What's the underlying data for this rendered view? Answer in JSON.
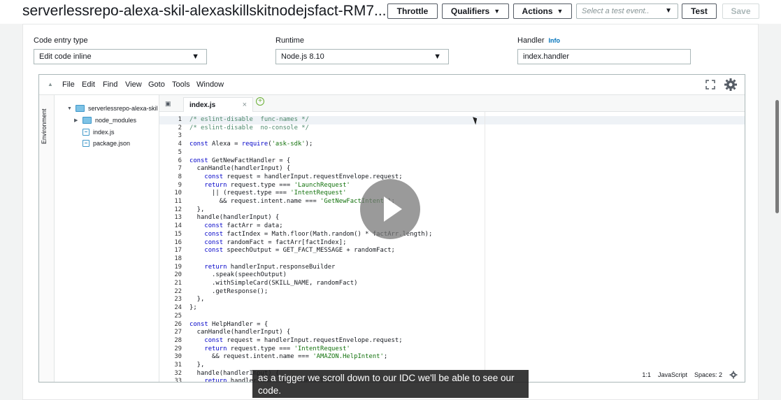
{
  "header": {
    "title": "serverlessrepo-alexa-skil-alexaskillskitnodejsfact-RM7...",
    "throttle_label": "Throttle",
    "qualifiers_label": "Qualifiers",
    "actions_label": "Actions",
    "test_event_placeholder": "Select a test event..",
    "test_label": "Test",
    "save_label": "Save"
  },
  "config": {
    "code_entry_label": "Code entry type",
    "code_entry_value": "Edit code inline",
    "runtime_label": "Runtime",
    "runtime_value": "Node.js 8.10",
    "handler_label": "Handler",
    "handler_info": "Info",
    "handler_value": "index.handler"
  },
  "ide": {
    "menu": [
      "File",
      "Edit",
      "Find",
      "View",
      "Goto",
      "Tools",
      "Window"
    ],
    "environment_label": "Environment",
    "tree": {
      "root": "serverlessrepo-alexa-skil",
      "items": [
        "node_modules",
        "index.js",
        "package.json"
      ]
    },
    "active_tab": "index.js",
    "status": {
      "position": "1:1",
      "language": "JavaScript",
      "spaces": "Spaces: 2"
    },
    "code_lines": [
      "/* eslint-disable  func-names */",
      "/* eslint-disable  no-console */",
      "",
      "const Alexa = require('ask-sdk');",
      "",
      "const GetNewFactHandler = {",
      "  canHandle(handlerInput) {",
      "    const request = handlerInput.requestEnvelope.request;",
      "    return request.type === 'LaunchRequest'",
      "      || (request.type === 'IntentRequest'",
      "        && request.intent.name === 'GetNewFactIntent');",
      "  },",
      "  handle(handlerInput) {",
      "    const factArr = data;",
      "    const factIndex = Math.floor(Math.random() * factArr.length);",
      "    const randomFact = factArr[factIndex];",
      "    const speechOutput = GET_FACT_MESSAGE + randomFact;",
      "",
      "    return handlerInput.responseBuilder",
      "      .speak(speechOutput)",
      "      .withSimpleCard(SKILL_NAME, randomFact)",
      "      .getResponse();",
      "  },",
      "};",
      "",
      "const HelpHandler = {",
      "  canHandle(handlerInput) {",
      "    const request = handlerInput.requestEnvelope.request;",
      "    return request.type === 'IntentRequest'",
      "      && request.intent.name === 'AMAZON.HelpIntent';",
      "  },",
      "  handle(handlerInput) {",
      "    return handlerInput.responseBuilder"
    ]
  },
  "video": {
    "caption": "as a trigger we scroll down to our IDC we'll be able to see our code."
  }
}
